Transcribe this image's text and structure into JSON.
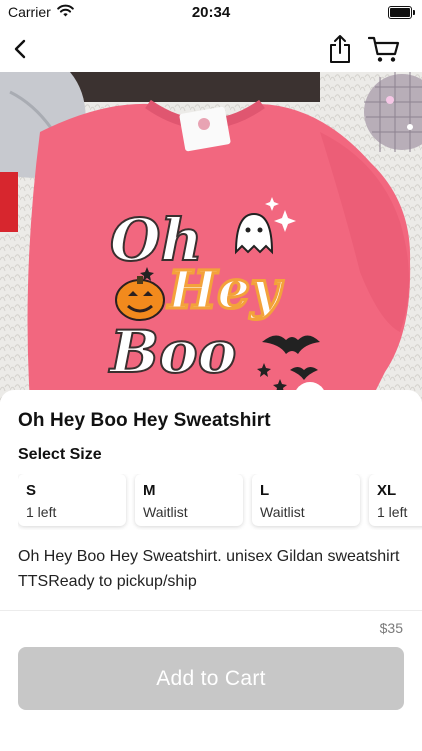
{
  "status_bar": {
    "carrier": "Carrier",
    "time": "20:34"
  },
  "nav": {
    "back_icon": "chevron-left-icon",
    "share_icon": "share-icon",
    "cart_icon": "cart-icon"
  },
  "hero": {
    "graphic_words": [
      "Oh",
      "Hey",
      "Boo"
    ],
    "shirt_color": "#f2677f"
  },
  "product": {
    "title": "Oh Hey Boo Hey Sweatshirt",
    "select_size_label": "Select Size",
    "sizes": [
      {
        "name": "S",
        "status": "1 left"
      },
      {
        "name": "M",
        "status": "Waitlist"
      },
      {
        "name": "L",
        "status": "Waitlist"
      },
      {
        "name": "XL",
        "status": "1 left"
      }
    ],
    "description": "Oh Hey Boo Hey Sweatshirt. unisex Gildan sweatshirt TTSReady to pickup/ship"
  },
  "footer": {
    "price": "$35",
    "add_to_cart_label": "Add to Cart",
    "button_color": "#c7c7c7"
  }
}
